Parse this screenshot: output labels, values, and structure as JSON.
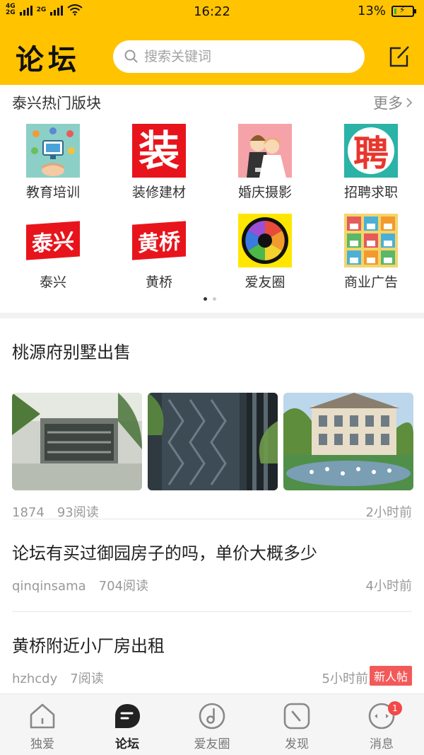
{
  "status_bar": {
    "network_1": "4G",
    "network_1b": "2G",
    "network_2": "2G",
    "time": "16:22",
    "battery": "13%",
    "battery_level": 0.13
  },
  "header": {
    "title": "论坛",
    "search_placeholder": "搜索关键词",
    "icons": [
      "search-icon",
      "edit-icon"
    ]
  },
  "categories": {
    "heading": "泰兴热门版块",
    "more_label": "更多",
    "items": [
      {
        "label": "教育培训",
        "icon": "education-icon"
      },
      {
        "label": "装修建材",
        "icon": "decoration-icon",
        "icon_text": "装"
      },
      {
        "label": "婚庆摄影",
        "icon": "wedding-icon"
      },
      {
        "label": "招聘求职",
        "icon": "recruit-icon",
        "icon_text": "聘"
      },
      {
        "label": "泰兴",
        "icon": "taixing-icon",
        "icon_text": "泰兴"
      },
      {
        "label": "黄桥",
        "icon": "huangqiao-icon",
        "icon_text": "黄桥"
      },
      {
        "label": "爱友圈",
        "icon": "aperture-icon"
      },
      {
        "label": "商业广告",
        "icon": "shops-icon"
      }
    ],
    "page_count": 2,
    "current_page": 1
  },
  "posts": [
    {
      "title": "桃源府别墅出售",
      "author": "1874",
      "reads": "93阅读",
      "time": "2小时前",
      "thumbnails": 3
    },
    {
      "title": "论坛有买过御园房子的吗，单价大概多少",
      "author": "qinqinsama",
      "reads": "704阅读",
      "time": "4小时前"
    },
    {
      "title": "黄桥附近小厂房出租",
      "author": "hzhcdy",
      "reads": "7阅读",
      "time": "5小时前",
      "badge": "新人帖"
    }
  ],
  "tabbar": {
    "tabs": [
      {
        "label": "独爱",
        "icon": "home-icon"
      },
      {
        "label": "论坛",
        "icon": "forum-icon",
        "active": true
      },
      {
        "label": "爱友圈",
        "icon": "music-disc-icon"
      },
      {
        "label": "发现",
        "icon": "compass-icon"
      },
      {
        "label": "消息",
        "icon": "message-icon",
        "badge": "1"
      }
    ]
  },
  "colors": {
    "brand_yellow": "#ffc300",
    "badge_red": "#f25a5a",
    "battery_green": "#31b544"
  }
}
